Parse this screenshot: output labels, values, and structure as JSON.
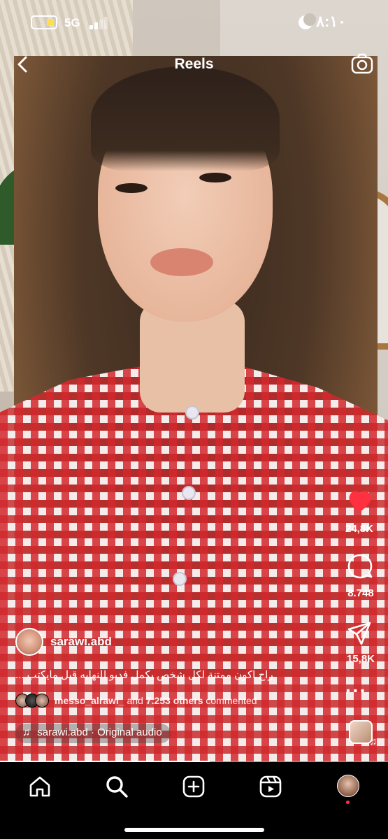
{
  "status_bar": {
    "network": "5G",
    "time": "٨:١٠"
  },
  "header": {
    "title": "Reels"
  },
  "actions": {
    "likes": "24,8K",
    "comments": "8.748",
    "shares": "15,8K"
  },
  "post": {
    "username": "sarawi.abd",
    "caption": "راح اكون ممتنة لكل شخص يكمل فديو للنهايه قبل مايكتب ...",
    "commenters": {
      "name": "messo_alrawi_",
      "and_text": "and",
      "others": "7.253 others",
      "suffix": "commented"
    },
    "audio": "sarawi.abd · Original audio"
  },
  "playback": {
    "progress": 0.54
  },
  "colors": {
    "like": "#ff3040",
    "battery_low": "#ffe04b"
  },
  "icons": [
    "back-icon",
    "camera-icon",
    "heart-icon",
    "comment-icon",
    "send-icon",
    "more-icon",
    "music-note-icon",
    "home-icon",
    "search-icon",
    "create-icon",
    "reels-icon",
    "profile-icon"
  ]
}
